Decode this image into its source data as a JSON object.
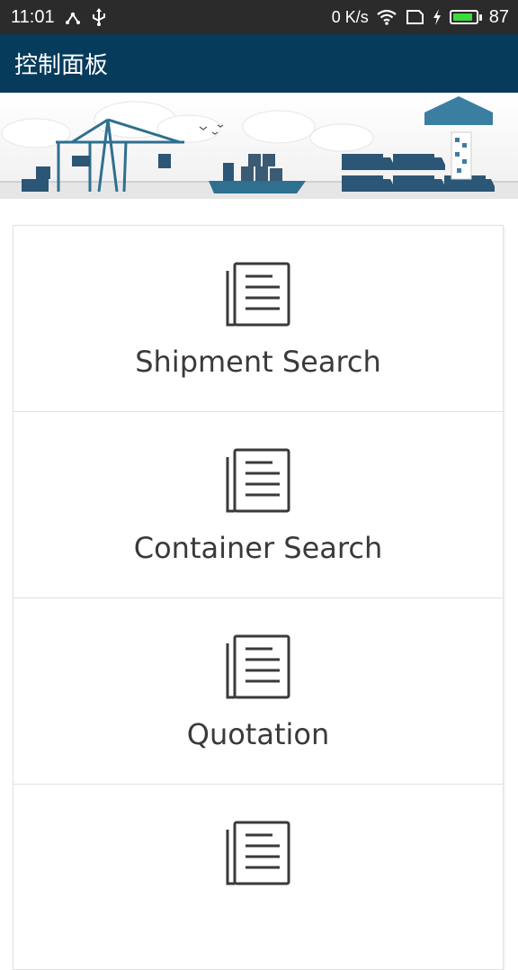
{
  "status_bar": {
    "time": "11:01",
    "network_speed": "0 K/s",
    "battery_level": "87",
    "icons": [
      "usb-share-icon",
      "usb-icon",
      "wifi-icon",
      "sim-icon",
      "charging-icon",
      "battery-icon"
    ],
    "battery_color": "#3ddc3d"
  },
  "app_bar": {
    "title": "控制面板",
    "background": "#073b5c"
  },
  "banner": {
    "illustration": "port-cranes-ship-trucks"
  },
  "menu": {
    "items": [
      {
        "label": "Shipment Search",
        "icon": "document-list-icon"
      },
      {
        "label": "Container Search",
        "icon": "document-list-icon"
      },
      {
        "label": "Quotation",
        "icon": "document-list-icon"
      },
      {
        "label": "",
        "icon": "document-list-icon"
      }
    ]
  }
}
